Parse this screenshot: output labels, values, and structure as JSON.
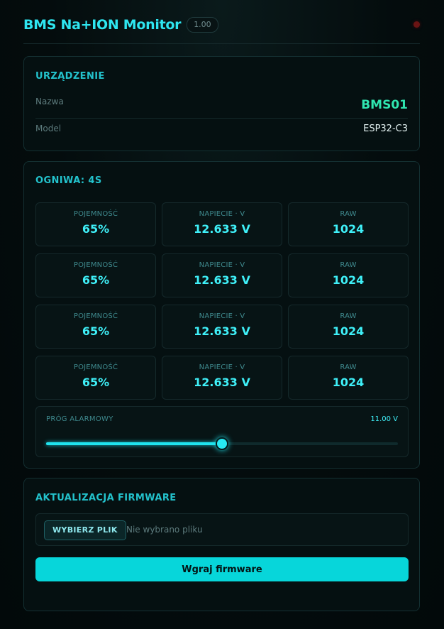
{
  "header": {
    "title": "BMS Na+ION Monitor",
    "version": "1.00",
    "status_color": "#6a1414"
  },
  "device": {
    "section_title": "URZĄDZENIE",
    "name_label": "Nazwa",
    "name_value": "BMS01",
    "model_label": "Model",
    "model_value": "ESP32-C3"
  },
  "cells": {
    "section_title": "OGNIWA: 4S",
    "rows": [
      {
        "capacity_label": "POJEMNOŚĆ",
        "capacity": "65%",
        "voltage_label": "NAPIECIE · V",
        "voltage": "12.633 V",
        "raw_label": "RAW",
        "raw": "1024"
      },
      {
        "capacity_label": "POJEMNOŚĆ",
        "capacity": "65%",
        "voltage_label": "NAPIECIE · V",
        "voltage": "12.633 V",
        "raw_label": "RAW",
        "raw": "1024"
      },
      {
        "capacity_label": "POJEMNOŚĆ",
        "capacity": "65%",
        "voltage_label": "NAPIECIE · V",
        "voltage": "12.633 V",
        "raw_label": "RAW",
        "raw": "1024"
      },
      {
        "capacity_label": "POJEMNOŚĆ",
        "capacity": "65%",
        "voltage_label": "NAPIECIE · V",
        "voltage": "12.633 V",
        "raw_label": "RAW",
        "raw": "1024"
      }
    ],
    "threshold": {
      "label": "PRÓG ALARMOWY",
      "value": "11.00 V",
      "slider_fraction": 0.5
    }
  },
  "firmware": {
    "section_title": "AKTUALIZACJA FIRMWARE",
    "choose_file_label": "WYBIERZ PLIK",
    "file_status": "Nie wybrano pliku",
    "upload_label": "Wgraj firmware"
  },
  "colors": {
    "accent": "#2ee6f0",
    "name_value": "#2fe6b0",
    "button": "#07d6da",
    "background": "#040c0d"
  }
}
